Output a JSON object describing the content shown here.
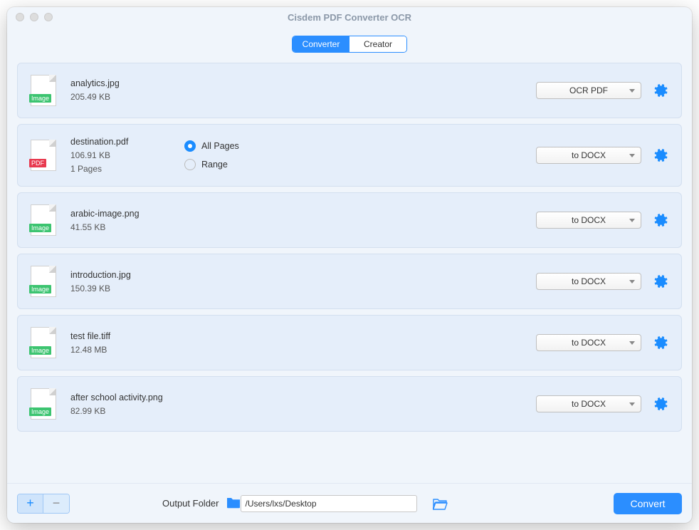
{
  "title": "Cisdem PDF Converter OCR",
  "tabs": {
    "converter": "Converter",
    "creator": "Creator"
  },
  "pageOptions": {
    "all": "All Pages",
    "range": "Range"
  },
  "files": [
    {
      "name": "analytics.jpg",
      "size": "205.49 KB",
      "type": "image",
      "format": "OCR PDF",
      "hasPages": false
    },
    {
      "name": "destination.pdf",
      "size": "106.91 KB",
      "pages": "1 Pages",
      "type": "pdf",
      "format": "to DOCX",
      "hasPages": true
    },
    {
      "name": "arabic-image.png",
      "size": "41.55 KB",
      "type": "image",
      "format": "to DOCX",
      "hasPages": false
    },
    {
      "name": "introduction.jpg",
      "size": "150.39 KB",
      "type": "image",
      "format": "to DOCX",
      "hasPages": false
    },
    {
      "name": "test file.tiff",
      "size": "12.48 MB",
      "type": "image",
      "format": "to DOCX",
      "hasPages": false
    },
    {
      "name": "after school activity.png",
      "size": "82.99 KB",
      "type": "image",
      "format": "to DOCX",
      "hasPages": false
    }
  ],
  "footer": {
    "outputLabel": "Output Folder",
    "outputPath": "/Users/lxs/Desktop",
    "convert": "Convert"
  },
  "badgeText": {
    "image": "Image",
    "pdf": "PDF"
  }
}
